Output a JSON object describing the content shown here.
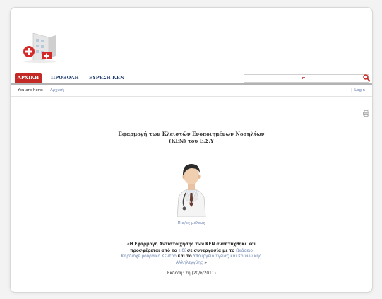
{
  "nav": {
    "items": [
      "ΑΡΧΙΚΗ",
      "ΠΡΟΒΟΛΗ",
      "ΕΥΡΕΣΗ ΚΕΝ"
    ],
    "active_index": 0
  },
  "search": {
    "value": ""
  },
  "breadcrumb": {
    "label": "You are here:",
    "current": "Αρχική"
  },
  "user_menu": {
    "separator": "|",
    "login": "Login"
  },
  "main": {
    "title_line1": "Εφαρμογή των Κλειστών Ενοποιημένων Νοσηλίων",
    "title_line2": "(ΚΕΝ) του Ε.Σ.Υ",
    "user_link": "Πιο/ος μέλους",
    "quote": {
      "open": "«Η Εφαρμογή Αντιστοίχησης των ΚΕΝ αναπτύχθηκε και προσφέρεται από το",
      "small1": "ε δί",
      "mid": "σε συνεργασία με το",
      "link1": "Ωνάσειο Καρδιοχειρουργικό Κέντρο",
      "and": "και το",
      "link2": "Υπουργείο Υγείας και Κοινωνικής Αλληλεγγύης",
      "close": "»"
    },
    "version": "Έκδοση: 2η (20/6/2011)"
  },
  "colors": {
    "accent": "#c42a25",
    "link": "#6f86b2",
    "nav_text": "#1e3a6e"
  }
}
